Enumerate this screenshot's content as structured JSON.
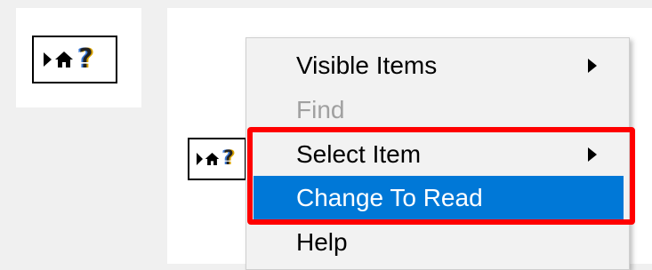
{
  "palette": {
    "icon_name": "property-node-icon",
    "glyph": "?"
  },
  "diagram": {
    "node_icon_name": "property-node-icon",
    "glyph": "?"
  },
  "context_menu": {
    "items": [
      {
        "label": "Visible Items",
        "enabled": true,
        "submenu": true,
        "highlighted": false
      },
      {
        "label": "Find",
        "enabled": false,
        "submenu": false,
        "highlighted": false
      },
      {
        "label": "Select Item",
        "enabled": true,
        "submenu": true,
        "highlighted": false
      },
      {
        "label": "Change To Read",
        "enabled": true,
        "submenu": false,
        "highlighted": true
      },
      {
        "label": "Help",
        "enabled": true,
        "submenu": false,
        "highlighted": false
      }
    ]
  },
  "colors": {
    "highlight": "#0078d7",
    "annotation": "#ff0000",
    "disabled_text": "#a0a0a0"
  }
}
